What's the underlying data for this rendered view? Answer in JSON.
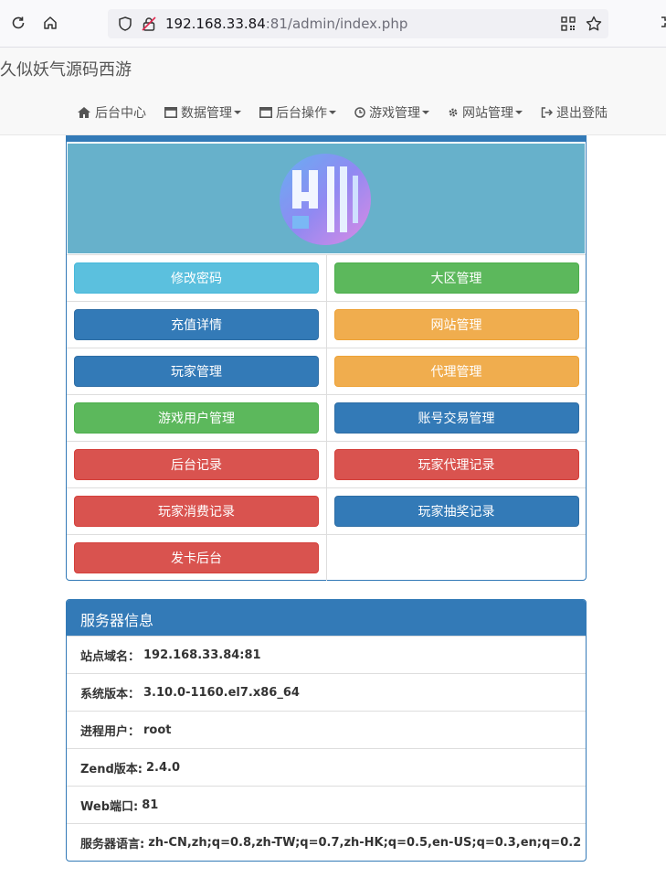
{
  "browser": {
    "url_host": "192.168.33.84",
    "url_rest": ":81/admin/index.php"
  },
  "site": {
    "brand": "久似妖气源码西游",
    "nav": [
      {
        "label": "后台中心",
        "icon": "home-icon"
      },
      {
        "label": "数据管理",
        "icon": "window-icon"
      },
      {
        "label": "后台操作",
        "icon": "window-icon"
      },
      {
        "label": "游戏管理",
        "icon": "clock-icon"
      },
      {
        "label": "网站管理",
        "icon": "gear-icon"
      },
      {
        "label": "退出登陆",
        "icon": "logout-icon"
      }
    ]
  },
  "buttons": [
    {
      "label": "修改密码",
      "color": "#5bc0de"
    },
    {
      "label": "大区管理",
      "color": "#5cb85c"
    },
    {
      "label": "充值详情",
      "color": "#337ab7"
    },
    {
      "label": "网站管理",
      "color": "#f0ad4e"
    },
    {
      "label": "玩家管理",
      "color": "#337ab7"
    },
    {
      "label": "代理管理",
      "color": "#f0ad4e"
    },
    {
      "label": "游戏用户管理",
      "color": "#5cb85c"
    },
    {
      "label": "账号交易管理",
      "color": "#337ab7"
    },
    {
      "label": "后台记录",
      "color": "#d9534f"
    },
    {
      "label": "玩家代理记录",
      "color": "#d9534f"
    },
    {
      "label": "玩家消费记录",
      "color": "#d9534f"
    },
    {
      "label": "玩家抽奖记录",
      "color": "#337ab7"
    },
    {
      "label": "发卡后台",
      "color": "#d9534f"
    }
  ],
  "server_info": {
    "title": "服务器信息",
    "rows": [
      {
        "label": "站点域名：",
        "value": "192.168.33.84:81"
      },
      {
        "label": "系统版本：",
        "value": "3.10.0-1160.el7.x86_64"
      },
      {
        "label": "进程用户：",
        "value": "root"
      },
      {
        "label": "Zend版本:",
        "value": "2.4.0"
      },
      {
        "label": "Web端口:",
        "value": "81"
      },
      {
        "label": "服务器语言:",
        "value": "zh-CN,zh;q=0.8,zh-TW;q=0.7,zh-HK;q=0.5,en-US;q=0.3,en;q=0.2"
      }
    ]
  }
}
